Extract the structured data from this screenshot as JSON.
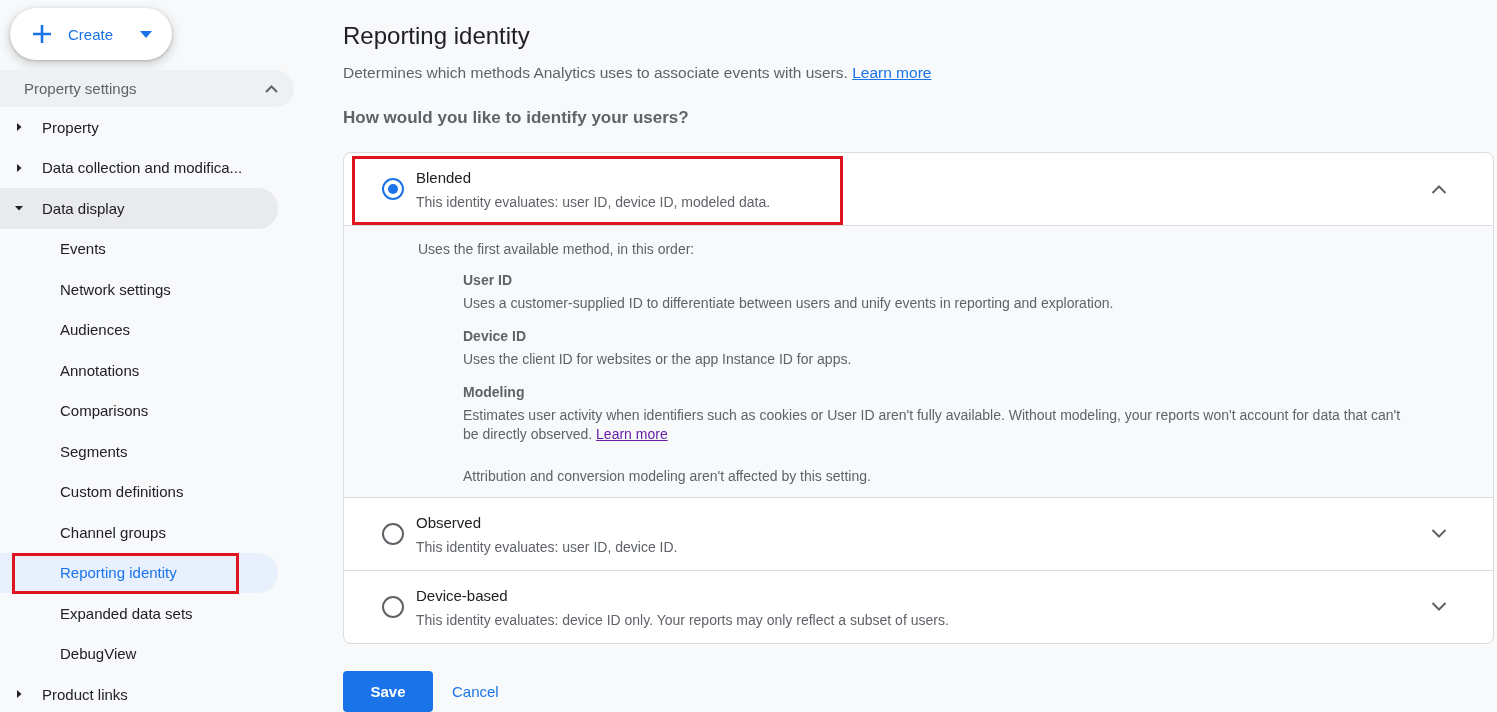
{
  "sidebar": {
    "create_button": {
      "label": "Create"
    },
    "section": {
      "label": "Property settings",
      "expanded": true
    },
    "items": [
      {
        "label": "Property",
        "expanded": false
      },
      {
        "label": "Data collection and modifica...",
        "expanded": false
      },
      {
        "label": "Data display",
        "expanded": true,
        "children": [
          {
            "label": "Events",
            "selected": false,
            "highlighted": false
          },
          {
            "label": "Network settings",
            "selected": false,
            "highlighted": false
          },
          {
            "label": "Audiences",
            "selected": false,
            "highlighted": false
          },
          {
            "label": "Annotations",
            "selected": false,
            "highlighted": false
          },
          {
            "label": "Comparisons",
            "selected": false,
            "highlighted": false
          },
          {
            "label": "Segments",
            "selected": false,
            "highlighted": false
          },
          {
            "label": "Custom definitions",
            "selected": false,
            "highlighted": false
          },
          {
            "label": "Channel groups",
            "selected": false,
            "highlighted": false
          },
          {
            "label": "Reporting identity",
            "selected": true,
            "highlighted": true
          },
          {
            "label": "Expanded data sets",
            "selected": false,
            "highlighted": false
          },
          {
            "label": "DebugView",
            "selected": false,
            "highlighted": false
          }
        ]
      },
      {
        "label": "Product links",
        "expanded": false
      }
    ]
  },
  "main": {
    "title": "Reporting identity",
    "description": "Determines which methods Analytics uses to associate events with users.",
    "description_link": "Learn more",
    "question": "How would you like to identify your users?",
    "options": [
      {
        "label": "Blended",
        "description": "This identity evaluates: user ID, device ID, modeled data.",
        "selected": true,
        "expanded": true,
        "highlighted": true,
        "details": {
          "intro": "Uses the first available method, in this order:",
          "methods": [
            {
              "heading": "User ID",
              "text": "Uses a customer-supplied ID to differentiate between users and unify events in reporting and exploration."
            },
            {
              "heading": "Device ID",
              "text": "Uses the client ID for websites or the app Instance ID for apps."
            },
            {
              "heading": "Modeling",
              "text": "Estimates user activity when identifiers such as cookies or User ID aren't fully available. Without modeling, your reports won't account for data that can't be directly observed.",
              "link": "Learn more"
            }
          ],
          "note": "Attribution and conversion modeling aren't affected by this setting."
        }
      },
      {
        "label": "Observed",
        "description": "This identity evaluates: user ID, device ID.",
        "selected": false,
        "expanded": false,
        "highlighted": false
      },
      {
        "label": "Device-based",
        "description": "This identity evaluates: device ID only. Your reports may only reflect a subset of users.",
        "selected": false,
        "expanded": false,
        "highlighted": false
      }
    ],
    "buttons": {
      "save": "Save",
      "cancel": "Cancel"
    }
  }
}
